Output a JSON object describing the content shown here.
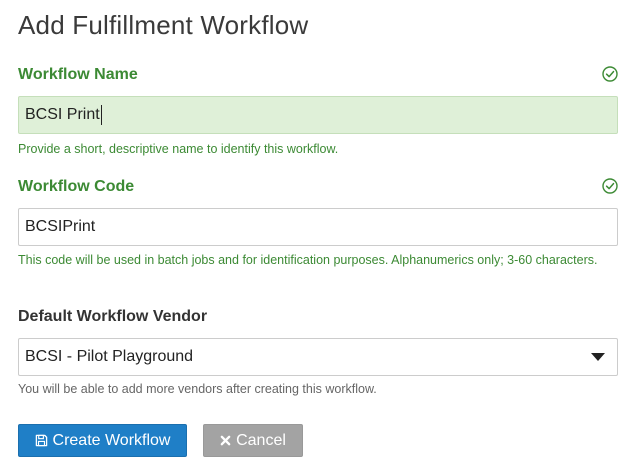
{
  "page": {
    "title": "Add Fulfillment Workflow"
  },
  "form": {
    "name_field": {
      "label": "Workflow Name",
      "value": "BCSI Print",
      "help": "Provide a short, descriptive name to identify this workflow.",
      "status_icon": "check-circle-icon"
    },
    "code_field": {
      "label": "Workflow Code",
      "value": "BCSIPrint",
      "help": "This code will be used in batch jobs and for identification purposes. Alphanumerics only; 3-60 characters.",
      "status_icon": "check-circle-icon"
    },
    "vendor_field": {
      "label": "Default Workflow Vendor",
      "selected": "BCSI - Pilot Playground",
      "help": "You will be able to add more vendors after creating this workflow."
    }
  },
  "buttons": {
    "create": {
      "label": "Create Workflow",
      "icon": "save-icon"
    },
    "cancel": {
      "label": "Cancel",
      "icon": "close-icon"
    }
  },
  "colors": {
    "success": "#3c8a34",
    "success_bg": "#dff0d8",
    "primary": "#1f7fc7",
    "secondary": "#a3a3a3"
  }
}
